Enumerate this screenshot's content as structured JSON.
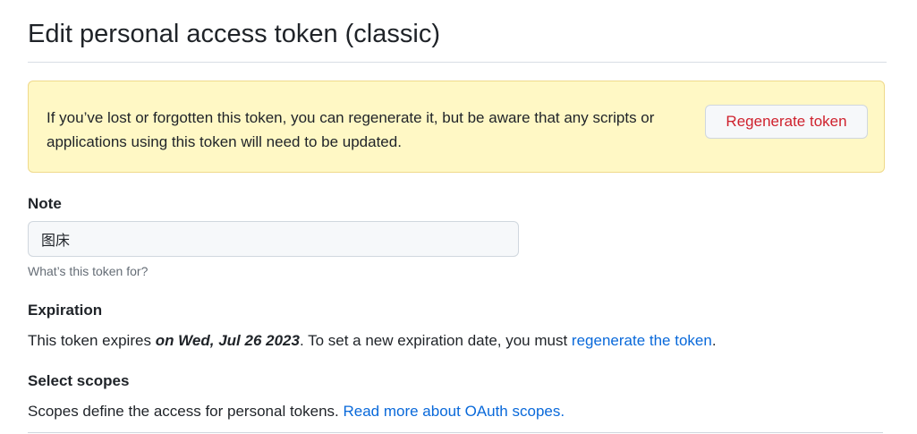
{
  "page": {
    "title": "Edit personal access token (classic)"
  },
  "flash": {
    "message": "If you’ve lost or forgotten this token, you can regenerate it, but be aware that any scripts or applications using this token will need to be updated.",
    "regenerate_button_label": "Regenerate token"
  },
  "note": {
    "label": "Note",
    "value": "图床",
    "hint": "What’s this token for?"
  },
  "expiration": {
    "label": "Expiration",
    "prefix": "This token expires ",
    "date": "on Wed, Jul 26 2023",
    "middle": ". To set a new expiration date, you must ",
    "link_label": "regenerate the token",
    "suffix": "."
  },
  "scopes": {
    "label": "Select scopes",
    "description": "Scopes define the access for personal tokens. ",
    "link_label": "Read more about OAuth scopes."
  },
  "colors": {
    "flash_background": "#fff8c5",
    "flash_border": "#efd98b",
    "danger": "#cf222e",
    "link": "#0969da",
    "text": "#1f2328",
    "muted": "#656d76"
  }
}
